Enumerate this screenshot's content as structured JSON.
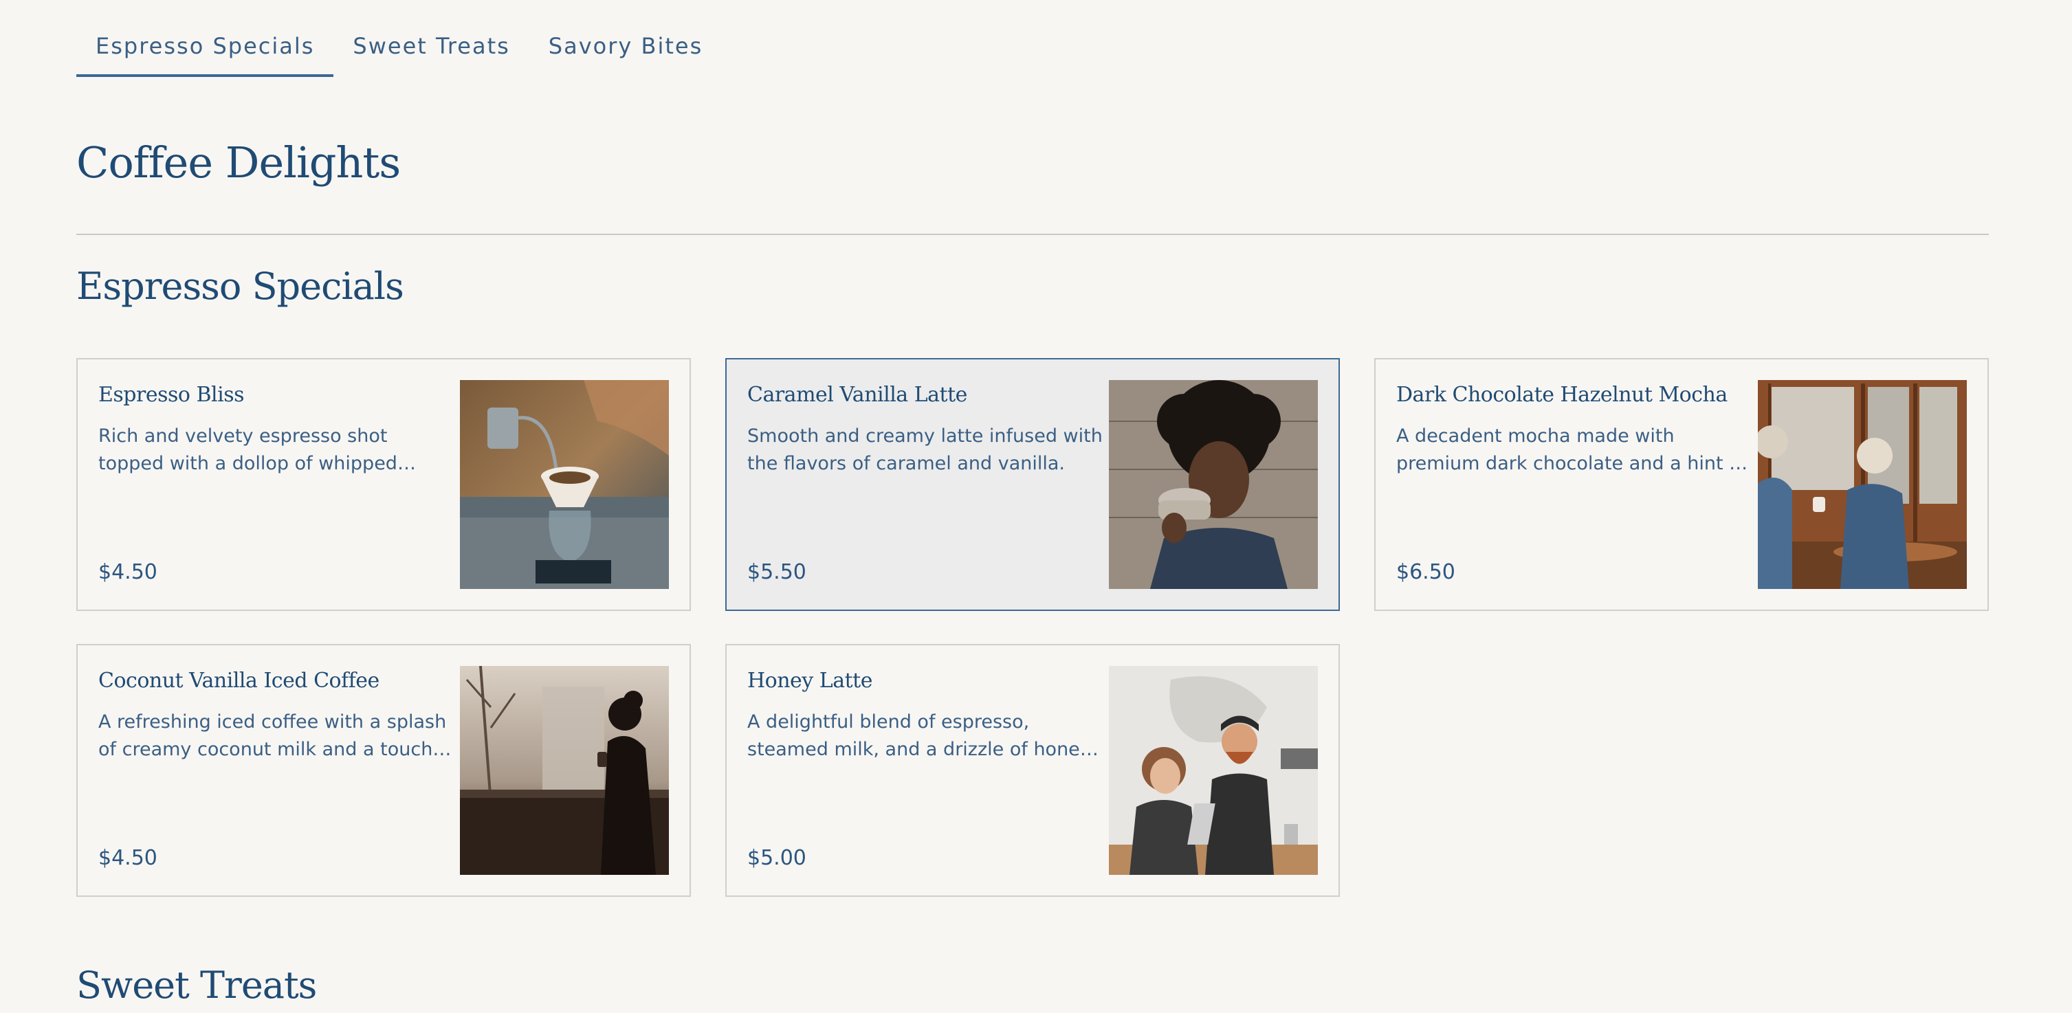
{
  "tabs": [
    {
      "label": "Espresso Specials",
      "active": true
    },
    {
      "label": "Sweet Treats",
      "active": false
    },
    {
      "label": "Savory Bites",
      "active": false
    }
  ],
  "page": {
    "title": "Coffee Delights"
  },
  "sections": {
    "espresso": {
      "title": "Espresso Specials",
      "items": [
        {
          "name": "Espresso Bliss",
          "description": "Rich and velvety espresso shot topped with a dollop of whipped cream.",
          "price": "$4.50",
          "image": "pour-over-coffee-photo"
        },
        {
          "name": "Caramel Vanilla Latte",
          "description": "Smooth and creamy latte infused with the flavors of caramel and vanilla.",
          "price": "$5.50",
          "image": "woman-drinking-coffee-photo",
          "selected": true
        },
        {
          "name": "Dark Chocolate Hazelnut Mocha",
          "description": "A decadent mocha made with premium dark chocolate and a hint of hazelnut.",
          "price": "$6.50",
          "image": "elderly-couple-cafe-photo"
        },
        {
          "name": "Coconut Vanilla Iced Coffee",
          "description": "A refreshing iced coffee with a splash of creamy coconut milk and a touch of vanilla.",
          "price": "$4.50",
          "image": "woman-window-silhouette-photo"
        },
        {
          "name": "Honey Latte",
          "description": "A delightful blend of espresso, steamed milk, and a drizzle of honey for sweetness.",
          "price": "$5.00",
          "image": "barista-couple-photo"
        }
      ]
    },
    "sweet": {
      "title": "Sweet Treats"
    }
  },
  "colors": {
    "background": "#f8f6f3",
    "primary": "#1f4b74",
    "accent": "#3b6a95",
    "border": "#cfcfcf",
    "selected_bg": "#ececec"
  }
}
